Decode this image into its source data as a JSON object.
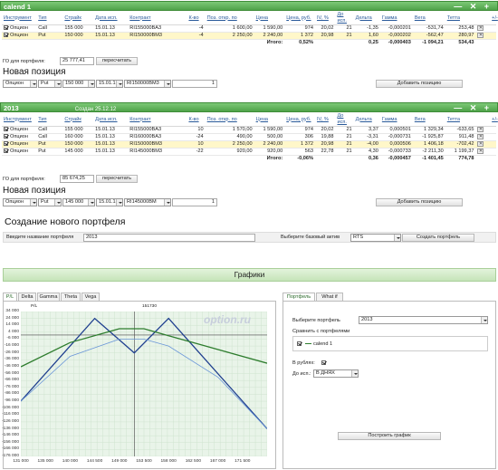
{
  "portfolio1": {
    "title": "calend 1",
    "headers": [
      "Инструмент",
      "Тип",
      "Страйк",
      "Дата исп.",
      "Контракт",
      "К-во",
      "Поз. откр. по",
      "Цена",
      "Цена, руб.",
      "IV, %",
      "До исп.",
      "Дельта",
      "Гамма",
      "Вега",
      "Тетта"
    ],
    "rows": [
      [
        "Опцион",
        "Call",
        "155 000",
        "15.01.13",
        "RI155000BA3",
        "-4",
        "1 600,00",
        "1 590,00",
        "974",
        "20,02",
        "21",
        "-1,35",
        "-0,000201",
        "-531,74",
        "253,48"
      ],
      [
        "Опцион",
        "Put",
        "150 000",
        "15.01.13",
        "RI150000BM3",
        "-4",
        "2 250,00",
        "2 240,00",
        "1 372",
        "20,98",
        "21",
        "1,60",
        "-0,000202",
        "-562,47",
        "280,97"
      ]
    ],
    "total_label": "Итого:",
    "total_pct": "0,52%",
    "total_delta": "0,25",
    "total_gamma": "-0,000403",
    "total_vega": "-1 094,21",
    "total_theta": "534,43",
    "go_label": "ГО для портфеля:",
    "go_value": "25 777,41",
    "recalc": "пересчитать"
  },
  "new_position": {
    "heading": "Новая позиция",
    "instrument": "Опцион",
    "type": "Put",
    "strike": "150 000",
    "date": "15.01.13",
    "contract": "RI150000BM3",
    "qty": "1",
    "add": "Добавить позицию"
  },
  "portfolio2": {
    "title": "2013",
    "created": "Создан 25.12.12",
    "rows": [
      [
        "Опцион",
        "Call",
        "155 000",
        "15.01.13",
        "RI155000BA3",
        "10",
        "1 570,00",
        "1 590,00",
        "974",
        "20,02",
        "21",
        "3,37",
        "0,000501",
        "1 329,34",
        "-633,65"
      ],
      [
        "Опцион",
        "Call",
        "160 000",
        "15.01.13",
        "RI160000BA3",
        "-24",
        "490,00",
        "500,00",
        "306",
        "19,88",
        "21",
        "-3,31",
        "-0,000731",
        "-1 925,87",
        "911,48"
      ],
      [
        "Опцион",
        "Put",
        "150 000",
        "15.01.13",
        "RI150000BM3",
        "10",
        "2 250,00",
        "2 240,00",
        "1 372",
        "20,98",
        "21",
        "-4,00",
        "0,000506",
        "1 406,18",
        "-702,42"
      ],
      [
        "Опцион",
        "Put",
        "145 000",
        "15.01.13",
        "RI145000BM3",
        "-22",
        "920,00",
        "920,00",
        "563",
        "22,78",
        "21",
        "4,30",
        "-0,000733",
        "-2 211,30",
        "1 199,37"
      ]
    ],
    "total_pct": "-0,06%",
    "total_delta": "0,36",
    "total_gamma": "-0,000457",
    "total_vega": "-1 401,45",
    "total_theta": "774,78",
    "go_value": "85 674,25",
    "np_strike": "145 000",
    "np_contract": "RI145000BM"
  },
  "create": {
    "heading": "Создание нового портфеля",
    "name_label": "Введите название портфеля",
    "name_value": "2013",
    "asset_label": "Выберите базовый актив",
    "asset_value": "RTS",
    "button": "Создать портфель"
  },
  "graphs": {
    "heading": "Графики",
    "tabs": [
      "P/L",
      "Delta",
      "Gamma",
      "Theta",
      "Vega"
    ],
    "side_tabs": [
      "Портфель",
      "What if"
    ],
    "watermark": "option.ru",
    "select_portfolio_label": "Выберите портфель",
    "select_portfolio_value": "2013",
    "compare_label": "Сравнить с портфелями",
    "compare_item": "calend 1",
    "rubles_label": "В рублях:",
    "days_label": "До исп.:",
    "days_value": "В ДНЯХ",
    "build": "Построить график",
    "ylabel": "P/L",
    "spot": "151730"
  },
  "chart_data": {
    "type": "line",
    "yticks": [
      "34 000",
      "24 000",
      "14 000",
      "4 000",
      "-6 000",
      "-16 000",
      "-26 000",
      "-36 000",
      "-46 000",
      "-56 000",
      "-66 000",
      "-76 000",
      "-86 000",
      "-96 000",
      "-106 000",
      "-116 000",
      "-126 000",
      "-136 000",
      "-146 000",
      "-156 000",
      "-166 000",
      "-176 000"
    ],
    "xticks": [
      "131 000",
      "135 000",
      "140 000",
      "144 500",
      "149 000",
      "153 500",
      "158 000",
      "162 500",
      "167 000",
      "171 500"
    ],
    "xlim": [
      131000,
      176000
    ],
    "ylim": [
      -176000,
      34000
    ],
    "series": [
      {
        "color": "#1f3f8f",
        "x": [
          131000,
          144500,
          151730,
          158000,
          176000
        ],
        "y": [
          -96000,
          24000,
          -26000,
          24000,
          -136000
        ]
      },
      {
        "color": "#6a96d8",
        "x": [
          131000,
          140000,
          149000,
          153500,
          158000,
          167000,
          176000
        ],
        "y": [
          -96000,
          -31000,
          -6000,
          -6000,
          -16000,
          -61000,
          -136000
        ]
      },
      {
        "color": "#2e7d2e",
        "x": [
          131000,
          140000,
          149000,
          153500,
          158000,
          176000
        ],
        "y": [
          -46000,
          -11000,
          9000,
          9000,
          -1000,
          -41000
        ]
      }
    ]
  }
}
